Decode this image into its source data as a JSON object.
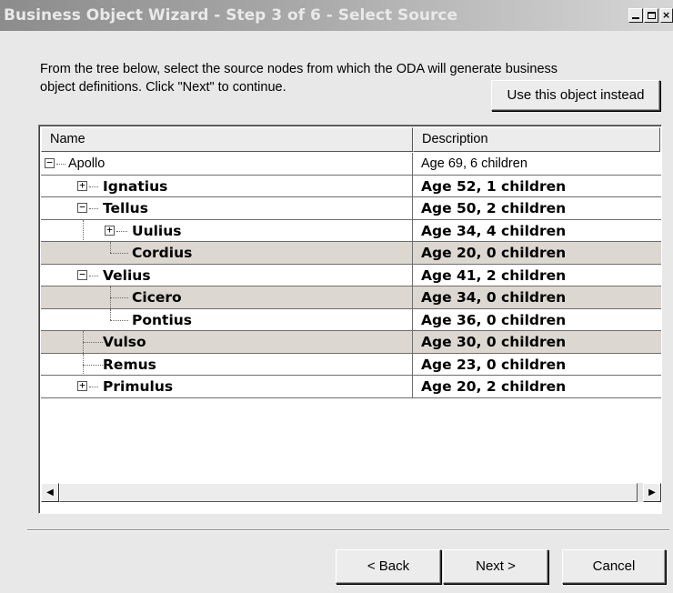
{
  "window": {
    "title": "Business Object Wizard - Step 3 of 6 - Select Source",
    "minimize_label": "_",
    "close_label": "×"
  },
  "instruction": {
    "line1": "From the tree below, select the source nodes from which the ODA will generate business",
    "line2": "object definitions. Click \"Next\" to continue."
  },
  "use_object_button": "Use this object instead",
  "tree": {
    "columns": {
      "name": "Name",
      "description": "Description"
    },
    "rows": [
      {
        "name": "Apollo",
        "description": "Age 69, 6 children",
        "expander": "−"
      },
      {
        "name": "Ignatius",
        "description": "Age 52, 1 children",
        "expander": "+"
      },
      {
        "name": "Tellus",
        "description": "Age 50, 2 children",
        "expander": "−"
      },
      {
        "name": "Uulius",
        "description": "Age 34, 4 children",
        "expander": "+"
      },
      {
        "name": "Cordius",
        "description": "Age 20, 0 children"
      },
      {
        "name": "Velius",
        "description": "Age 41, 2 children",
        "expander": "−"
      },
      {
        "name": "Cicero",
        "description": "Age 34, 0 children"
      },
      {
        "name": "Pontius",
        "description": "Age 36, 0 children"
      },
      {
        "name": "Vulso",
        "description": "Age 30, 0 children"
      },
      {
        "name": "Remus",
        "description": "Age 23, 0 children"
      },
      {
        "name": "Primulus",
        "description": "Age 20, 2 children",
        "expander": "+"
      }
    ],
    "scroll_left": "◀",
    "scroll_right": "▶"
  },
  "footer": {
    "back_label": "< Back",
    "next_label": "Next >",
    "cancel_label": "Cancel"
  }
}
